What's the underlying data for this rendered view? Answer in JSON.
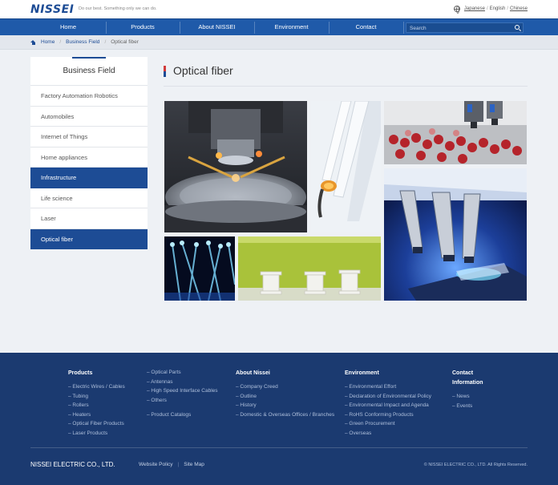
{
  "header": {
    "logo": "NISSEI",
    "tagline": "Do our best. Something only we can do.",
    "languages": [
      "Japanese",
      "English",
      "Chinese"
    ]
  },
  "nav": {
    "items": [
      "Home",
      "Products",
      "About NISSEI",
      "Environment",
      "Contact"
    ],
    "search_placeholder": "Search"
  },
  "breadcrumb": {
    "home": "Home",
    "parent": "Business Field",
    "current": "Optical fiber"
  },
  "sidebar": {
    "title": "Business Field",
    "items": [
      {
        "label": "Factory Automation Robotics",
        "active": false
      },
      {
        "label": "Automobiles",
        "active": false
      },
      {
        "label": "Internet of Things",
        "active": false
      },
      {
        "label": "Home appliances",
        "active": false
      },
      {
        "label": "Infrastructure",
        "active": true
      },
      {
        "label": "Life science",
        "active": false
      },
      {
        "label": "Laser",
        "active": false
      },
      {
        "label": "Optical fiber",
        "active": true
      }
    ]
  },
  "main": {
    "title": "Optical fiber"
  },
  "footer": {
    "products": {
      "title": "Products",
      "links": [
        "Electric Wires / Cables",
        "Tubing",
        "Rollers",
        "Heaters",
        "Optical Fiber Products",
        "Laser Products"
      ]
    },
    "products2": {
      "links": [
        "Optical Parts",
        "Antennas",
        "High Speed Interface Cables",
        "Others",
        "Product Catalogs"
      ]
    },
    "about": {
      "title": "About Nissei",
      "links": [
        "Company Creed",
        "Outline",
        "History",
        "Domestic & Overseas Offices / Branches"
      ]
    },
    "environment": {
      "title": "Environment",
      "links": [
        "Environmental Effort",
        "Declaration of Environmental Policy",
        "Environmental Impact and Agenda",
        "RoHS Conforming Products",
        "Green Procurement",
        "Overseas"
      ]
    },
    "contact": {
      "title": "Contact",
      "title2": "Information",
      "links": [
        "News",
        "Events"
      ]
    },
    "brand": "NISSEI ELECTRIC CO., LTD.",
    "bottom_links": [
      "Website Policy",
      "Site Map"
    ],
    "copyright": "© NISSEI ELECTRIC CO., LTD. All Rights Reserved."
  },
  "colors": {
    "brand_blue": "#1d4c95",
    "nav_blue": "#1f5aa9",
    "footer_navy": "#1b3a70",
    "accent_red": "#d13b3b"
  }
}
